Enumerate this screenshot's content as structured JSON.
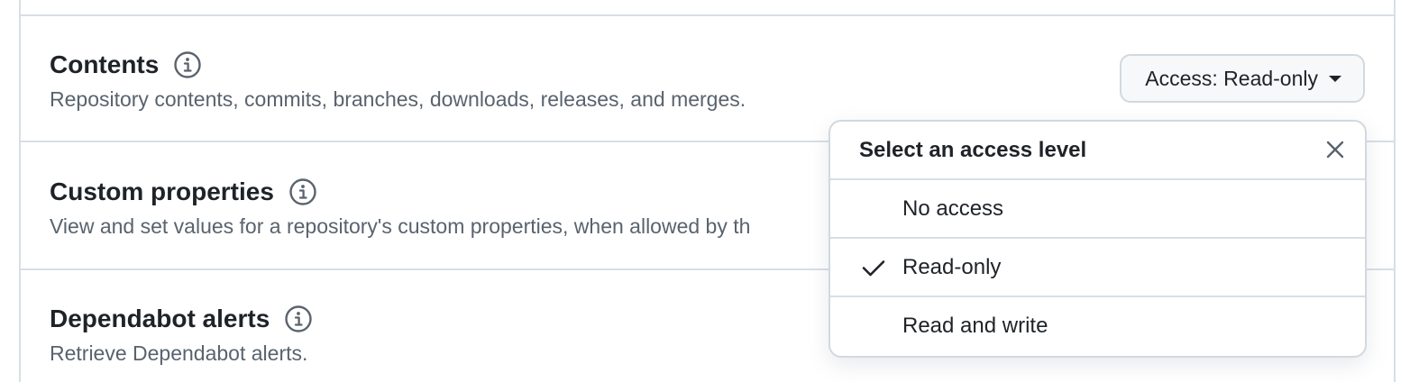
{
  "permissions": [
    {
      "title": "Contents",
      "description": "Repository contents, commits, branches, downloads, releases, and merges.",
      "info_icon": "info-icon"
    },
    {
      "title": "Custom properties",
      "description": "View and set values for a repository's custom properties, when allowed by th",
      "info_icon": "info-icon"
    },
    {
      "title": "Dependabot alerts",
      "description": "Retrieve Dependabot alerts.",
      "info_icon": "info-icon"
    }
  ],
  "access_button": {
    "label": "Access: Read-only",
    "icon": "caret-down-icon"
  },
  "dropdown": {
    "title": "Select an access level",
    "close_icon": "x-icon",
    "options": [
      {
        "label": "No access",
        "selected": false
      },
      {
        "label": "Read-only",
        "selected": true
      },
      {
        "label": "Read and write",
        "selected": false
      }
    ]
  },
  "colors": {
    "text": "#1f2328",
    "muted": "#59636e",
    "border": "#d8dee4",
    "button_bg": "#f6f8fa"
  }
}
